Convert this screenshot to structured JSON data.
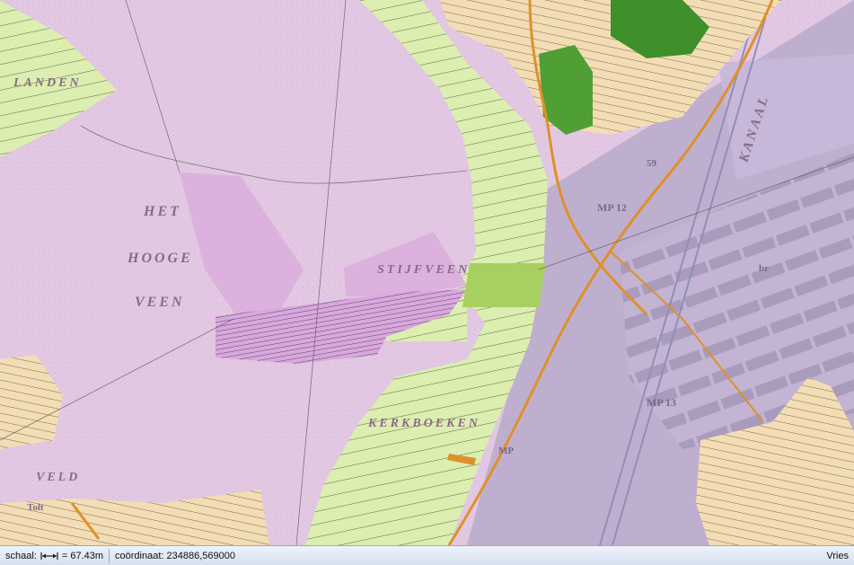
{
  "map": {
    "labels": {
      "landen": "LANDEN",
      "het": "HET",
      "hooge": "HOOGE",
      "veen": "VEEN",
      "stijfveen": "STIJFVEEN",
      "kanaal": "KANAAL",
      "kerkboeken": "KERKBOEKEN",
      "veld": "VELD",
      "mp12": "MP 12",
      "mp13": "MP 13",
      "mp": "MP",
      "n59": "59",
      "br": "br",
      "tolt": "Tolt"
    },
    "colors": {
      "heath": "#e2c8e2",
      "parcel_pink": "#dcaee0",
      "parcel_green_light": "#dceeb0",
      "parcel_green_mid": "#a8d060",
      "forest": "#3f8f2a",
      "parcel_sand": "#f3ddb4",
      "grey_overlay": "#b7a9c9",
      "road": "#e0902a"
    }
  },
  "statusbar": {
    "scale_label": "schaal:",
    "scale_icon": "scale-arrows-icon",
    "scale_value": "= 67.43m",
    "coord_label": "coördinaat:",
    "coord_value": "234886,569000",
    "mode": "Vries"
  }
}
